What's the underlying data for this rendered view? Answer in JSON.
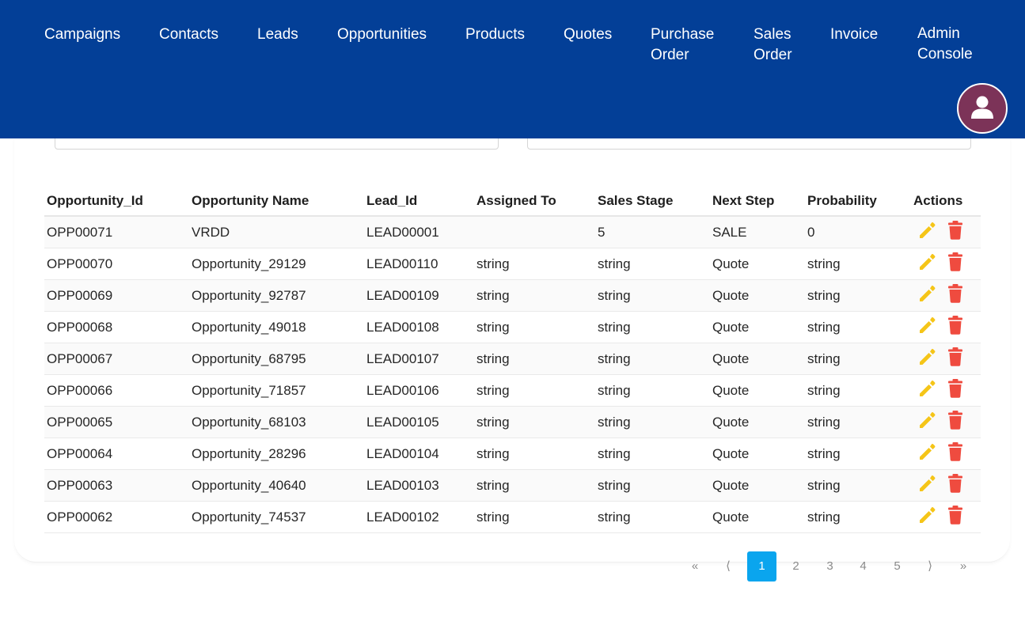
{
  "nav": {
    "items": [
      {
        "line1": "Campaigns",
        "line2": ""
      },
      {
        "line1": "Contacts",
        "line2": ""
      },
      {
        "line1": "Leads",
        "line2": ""
      },
      {
        "line1": "Opportunities",
        "line2": ""
      },
      {
        "line1": "Products",
        "line2": ""
      },
      {
        "line1": "Quotes",
        "line2": ""
      },
      {
        "line1": "Purchase",
        "line2": "Order"
      },
      {
        "line1": "Sales",
        "line2": "Order"
      },
      {
        "line1": "Invoice",
        "line2": ""
      },
      {
        "line1": "Admin",
        "line2": "Console"
      }
    ]
  },
  "colors": {
    "nav_bg": "#033f97",
    "avatar_bg": "#7c3358",
    "edit_icon": "#f5c518",
    "delete_icon": "#ef4b3f",
    "page_active": "#0aa5ee"
  },
  "table": {
    "headers": [
      "Opportunity_Id",
      "Opportunity Name",
      "Lead_Id",
      "Assigned To",
      "Sales Stage",
      "Next Step",
      "Probability",
      "Actions"
    ],
    "rows": [
      [
        "OPP00071",
        "VRDD",
        "LEAD00001",
        "",
        "5",
        "SALE",
        "0"
      ],
      [
        "OPP00070",
        "Opportunity_29129",
        "LEAD00110",
        "string",
        "string",
        "Quote",
        "string"
      ],
      [
        "OPP00069",
        "Opportunity_92787",
        "LEAD00109",
        "string",
        "string",
        "Quote",
        "string"
      ],
      [
        "OPP00068",
        "Opportunity_49018",
        "LEAD00108",
        "string",
        "string",
        "Quote",
        "string"
      ],
      [
        "OPP00067",
        "Opportunity_68795",
        "LEAD00107",
        "string",
        "string",
        "Quote",
        "string"
      ],
      [
        "OPP00066",
        "Opportunity_71857",
        "LEAD00106",
        "string",
        "string",
        "Quote",
        "string"
      ],
      [
        "OPP00065",
        "Opportunity_68103",
        "LEAD00105",
        "string",
        "string",
        "Quote",
        "string"
      ],
      [
        "OPP00064",
        "Opportunity_28296",
        "LEAD00104",
        "string",
        "string",
        "Quote",
        "string"
      ],
      [
        "OPP00063",
        "Opportunity_40640",
        "LEAD00103",
        "string",
        "string",
        "Quote",
        "string"
      ],
      [
        "OPP00062",
        "Opportunity_74537",
        "LEAD00102",
        "string",
        "string",
        "Quote",
        "string"
      ]
    ],
    "row_actions": [
      "pencil-icon",
      "trash-icon"
    ]
  },
  "pagination": {
    "first": "«",
    "prev": "⟨",
    "pages": [
      "1",
      "2",
      "3",
      "4",
      "5"
    ],
    "current": "1",
    "next": "⟩",
    "last": "»"
  }
}
